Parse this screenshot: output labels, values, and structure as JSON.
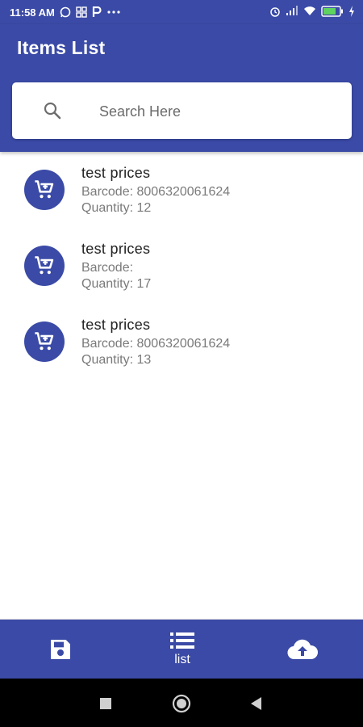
{
  "status_bar": {
    "time": "11:58 AM",
    "left_icons": [
      "whatsapp-icon",
      "grid-icon",
      "paytm-icon",
      "more-dots-icon"
    ],
    "right_icons": [
      "alarm-icon",
      "signal-icon",
      "wifi-icon",
      "battery-icon",
      "charging-icon"
    ]
  },
  "app_bar": {
    "title": "Items List"
  },
  "search": {
    "placeholder": "Search Here",
    "value": ""
  },
  "items": [
    {
      "name": "test  prices",
      "barcode": "Barcode: 8006320061624",
      "quantity": "Quantity: 12"
    },
    {
      "name": "test  prices",
      "barcode": "Barcode:",
      "quantity": "Quantity: 17"
    },
    {
      "name": "test  prices",
      "barcode": "Barcode: 8006320061624",
      "quantity": "Quantity: 13"
    }
  ],
  "bottom_nav": {
    "save_icon": "save-icon",
    "list_label": "list",
    "upload_icon": "cloud-upload-icon"
  },
  "colors": {
    "primary": "#3a4aa6",
    "background": "#ffffff",
    "secondary_text": "#7a7a7a"
  }
}
